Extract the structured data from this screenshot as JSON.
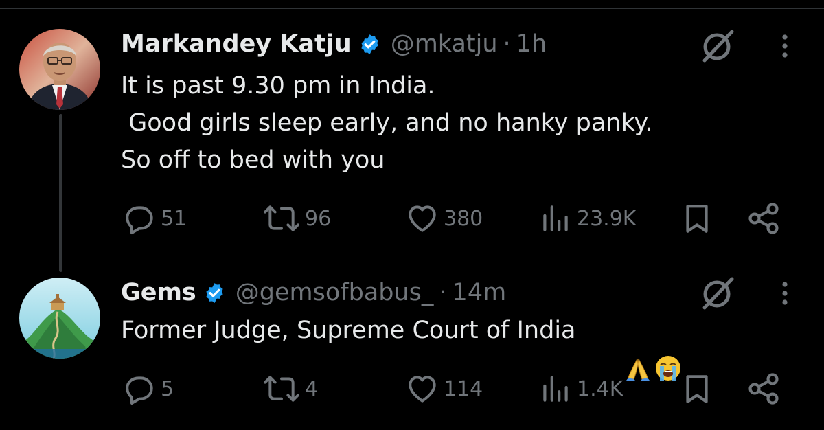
{
  "colors": {
    "background": "#000000",
    "text_primary": "#e7e9ea",
    "text_secondary": "#71767b",
    "verified_blue": "#1d9bf0",
    "divider": "#2f3336"
  },
  "tweets": [
    {
      "display_name": "Markandey Katju",
      "handle": "@mkatju",
      "separator": "·",
      "time": "1h",
      "verified": true,
      "text": "It is past 9.30 pm in India.\n Good girls sleep early, and no hanky panky.\nSo off to bed with you",
      "stats": {
        "replies": "51",
        "reposts": "96",
        "likes": "380",
        "views": "23.9K"
      }
    },
    {
      "display_name": "Gems",
      "handle": "@gemsofbabus_",
      "separator": "·",
      "time": "14m",
      "verified": true,
      "text": "Former Judge, Supreme Court of India",
      "emojis": [
        "folded-hands",
        "loudly-crying-face"
      ],
      "stats": {
        "replies": "5",
        "reposts": "4",
        "likes": "114",
        "views": "1.4K"
      }
    }
  ],
  "icons": {
    "reply": "reply-icon",
    "repost": "repost-icon",
    "like": "heart-icon",
    "views": "views-icon",
    "bookmark": "bookmark-icon",
    "share": "share-icon",
    "grok": "grok-icon",
    "more": "more-icon",
    "verified": "verified-badge-icon"
  }
}
